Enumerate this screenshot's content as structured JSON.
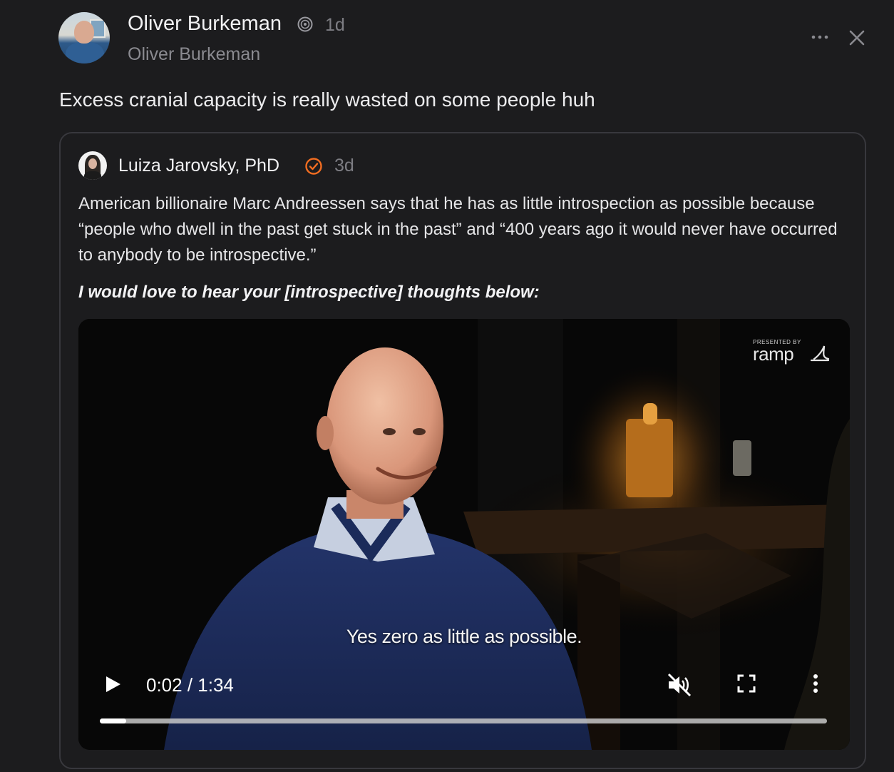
{
  "post": {
    "author_name": "Oliver Burkeman",
    "timestamp": "1d",
    "author_subtitle": "Oliver Burkeman",
    "text": "Excess cranial capacity is really wasted on some people huh",
    "more_icon": "more-horizontal-icon",
    "close_icon": "close-icon",
    "badge_icon": "subscriber-badge-icon"
  },
  "quote": {
    "author_name": "Luiza Jarovsky, PhD",
    "timestamp": "3d",
    "verified_icon": "verified-check-icon",
    "verified_color": "#f26d21",
    "body": "American billionaire Marc Andreessen says that he has as little introspection as possible because “people who dwell in the past get stuck in the past” and “400 years ago it would never have occurred to anybody to be introspective.”",
    "emphasis": "I would love to hear your [introspective] thoughts below:"
  },
  "video": {
    "watermark_small": "PRESENTED BY",
    "watermark_brand": "ramp",
    "subtitle": "Yes zero as little as possible.",
    "current_time": "0:02",
    "duration": "1:34",
    "time_display": "0:02 / 1:34",
    "progress_fraction": 0.036,
    "controls": {
      "play_icon": "play-icon",
      "mute_icon": "muted-speaker-icon",
      "fullscreen_icon": "fullscreen-icon",
      "menu_icon": "more-vertical-icon"
    }
  }
}
